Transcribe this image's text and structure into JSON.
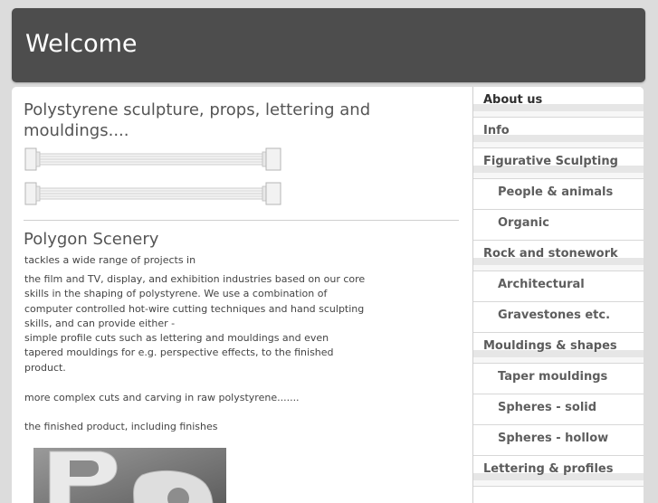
{
  "header": {
    "title": "Welcome"
  },
  "main": {
    "intro_title": "Polystyrene sculpture, props, lettering and mouldings....",
    "section_title": "Polygon Scenery",
    "tagline": "tackles a wide range of projects in",
    "paragraph1": "the film and TV, display, and exhibition industries based on our core skills in the shaping of polystyrene. We use a combination of computer controlled hot-wire cutting techniques and hand sculpting skills, and can provide either -",
    "paragraph2": "simple profile cuts such as lettering and mouldings and even tapered mouldings for e.g. perspective effects, to the finished product.",
    "paragraph3": "more complex cuts and carving in raw polystyrene.......",
    "paragraph4": "the finished product, including finishes"
  },
  "sidebar": {
    "items": [
      {
        "label": "About us"
      },
      {
        "label": "Info"
      },
      {
        "label": "Figurative Sculpting"
      },
      {
        "label": "People & animals"
      },
      {
        "label": "Organic"
      },
      {
        "label": "Rock and stonework"
      },
      {
        "label": "Architectural"
      },
      {
        "label": "Gravestones etc."
      },
      {
        "label": "Mouldings & shapes"
      },
      {
        "label": "Taper mouldings"
      },
      {
        "label": "Spheres - solid"
      },
      {
        "label": "Spheres - hollow"
      },
      {
        "label": "Lettering & profiles"
      }
    ]
  },
  "colors": {
    "header_bg": "#4d4d4d",
    "page_bg": "#dcdcdc",
    "nav_text": "#5b5b5b",
    "title_text": "#555555"
  }
}
